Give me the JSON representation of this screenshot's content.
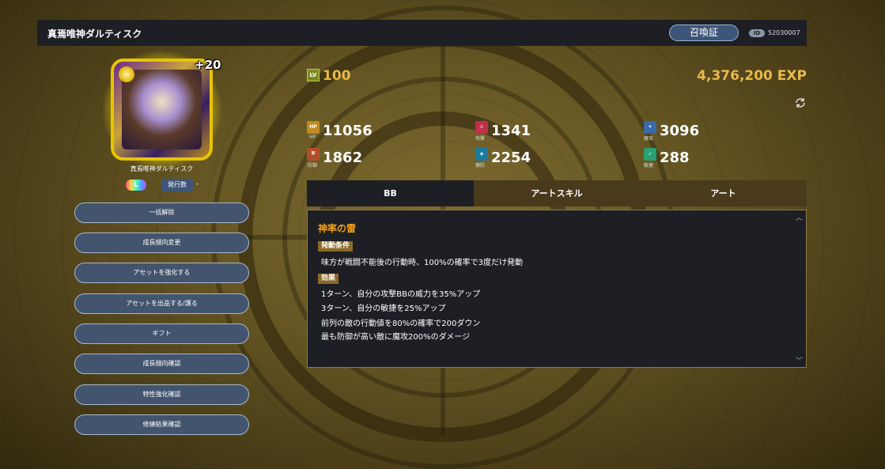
{
  "header": {
    "title": "真焉唯神ダルティスク",
    "summon_button": "召喚証",
    "id_label": "ID",
    "id_value": "52030007"
  },
  "character": {
    "plus_level": "+20",
    "name": "真焉唯神ダルティスク",
    "rarity_label": "L",
    "issue_label": "発行数",
    "issue_value": "-"
  },
  "actions": [
    "一括解除",
    "成長傾向変更",
    "アセットを強化する",
    "アセットを出品する/譲る",
    "ギフト",
    "成長傾向確認",
    "特性強化確認",
    "修練結果確認"
  ],
  "stats": {
    "lv_label": "LV",
    "lv_value": "100",
    "exp": "4,376,200 EXP",
    "items": [
      {
        "label": "HP",
        "value": "11056",
        "color": "#c08a20"
      },
      {
        "label": "攻撃",
        "value": "1341",
        "color": "#c0304a"
      },
      {
        "label": "魔攻",
        "value": "3096",
        "color": "#3a6aa8"
      },
      {
        "label": "防御",
        "value": "1862",
        "color": "#b0502a"
      },
      {
        "label": "魔防",
        "value": "2254",
        "color": "#1a7aa0"
      },
      {
        "label": "敏捷",
        "value": "288",
        "color": "#2aa070"
      }
    ]
  },
  "tabs": [
    "BB",
    "アートスキル",
    "アート"
  ],
  "skill": {
    "name": "神率の雷",
    "condition_label": "発動条件",
    "condition": "味方が戦闘不能後の行動時、100%の確率で3度だけ発動",
    "effect_label": "効果",
    "effects": [
      "1ターン、自分の攻撃BBの威力を35%アップ",
      "3ターン、自分の敏捷を25%アップ",
      "前列の敵の行動値を80%の確率で200ダウン",
      "最も防御が高い敵に魔攻200%のダメージ"
    ]
  },
  "colors": {
    "accent_gold": "#e8b84a",
    "panel_dark": "#1d1f24",
    "button_blue": "#43546e"
  }
}
